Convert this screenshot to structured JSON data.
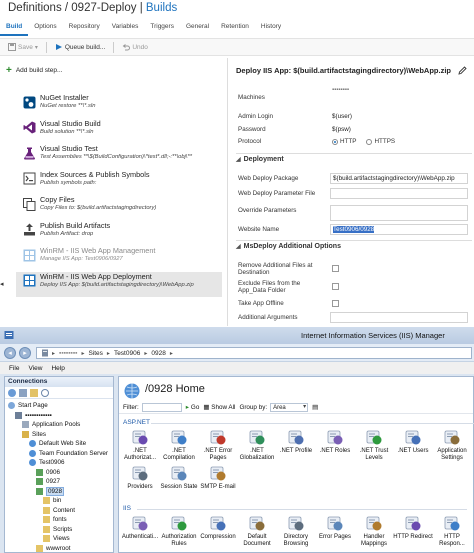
{
  "tfs": {
    "breadcrumb": {
      "part1": "Definitions / 0927-Deploy",
      "sep": " | ",
      "part2": "Builds"
    },
    "tabs": [
      "Build",
      "Options",
      "Repository",
      "Variables",
      "Triggers",
      "General",
      "Retention",
      "History"
    ],
    "toolbar": {
      "save": "Save",
      "queue": "Queue build...",
      "undo": "Undo"
    },
    "add_step": "Add build step...",
    "steps": [
      {
        "name": "NuGet Installer",
        "sub": "NuGet restore **\\*.sln",
        "icon": "nuget-icon",
        "disabled": false
      },
      {
        "name": "Visual Studio Build",
        "sub": "Build solution **\\*.sln",
        "icon": "visual-studio-icon",
        "disabled": false
      },
      {
        "name": "Visual Studio Test",
        "sub": "Test Assemblies **\\$(BuildConfiguration)\\*test*.dll;-:**\\obj\\**",
        "icon": "vs-test-icon",
        "disabled": false
      },
      {
        "name": "Index Sources & Publish Symbols",
        "sub": "Publish symbols path:",
        "icon": "symbols-icon",
        "disabled": false
      },
      {
        "name": "Copy Files",
        "sub": "Copy Files to: $(build.artifactstagingdirectory)",
        "icon": "copy-files-icon",
        "disabled": false
      },
      {
        "name": "Publish Build Artifacts",
        "sub": "Publish Artifact: drop",
        "icon": "publish-artifacts-icon",
        "disabled": false
      },
      {
        "name": "WinRM - IIS Web App Management",
        "sub": "Manage IIS App: Test0906/0927",
        "icon": "winrm-icon",
        "disabled": true
      },
      {
        "name": "WinRM - IIS Web App Deployment",
        "sub": "Deploy IIS App: $(build.artifactstagingdirectory)\\WebApp.zip",
        "icon": "winrm-icon",
        "disabled": false,
        "selected": true
      }
    ],
    "details": {
      "title": "Deploy IIS App: $(build.artifactstagingdirectory)\\WebApp.zip",
      "machines_label": "Machines",
      "machines_value": "▪▪▪▪▪▪▪▪",
      "admin_login_label": "Admin Login",
      "admin_login_value": "$(user)",
      "password_label": "Password",
      "password_value": "$(psw)",
      "protocol_label": "Protocol",
      "protocol_options": [
        "HTTP",
        "HTTPS"
      ],
      "protocol_selected": "HTTP",
      "deployment_section": "Deployment",
      "web_deploy_package_label": "Web Deploy Package",
      "web_deploy_package_value": "$(build.artifactstagingdirectory)\\WebApp.zip",
      "web_deploy_param_label": "Web Deploy Parameter File",
      "override_params_label": "Override Parameters",
      "website_name_label": "Website Name",
      "website_name_value": "Test0906/0928",
      "msdeploy_section": "MsDeploy Additional Options",
      "remove_files_label": "Remove Additional Files at Destination",
      "exclude_files_label": "Exclude Files from the App_Data Folder",
      "take_offline_label": "Take App Offline",
      "additional_args_label": "Additional Arguments"
    }
  },
  "iis": {
    "title": "Internet Information Services (IIS) Manager",
    "address": [
      "▪▪▪▪▪▪▪▪",
      "Sites",
      "Test0906",
      "0928"
    ],
    "menu": [
      "File",
      "View",
      "Help"
    ],
    "connections_title": "Connections",
    "tree": [
      {
        "label": "Start Page",
        "indent": 0,
        "icon": "start-page-icon"
      },
      {
        "label": "▪▪▪▪▪▪▪▪▪▪▪▪",
        "indent": 1,
        "icon": "server-icon"
      },
      {
        "label": "Application Pools",
        "indent": 2,
        "icon": "app-pools-icon"
      },
      {
        "label": "Sites",
        "indent": 2,
        "icon": "sites-icon"
      },
      {
        "label": "Default Web Site",
        "indent": 3,
        "icon": "website-icon"
      },
      {
        "label": "Team Foundation Server",
        "indent": 3,
        "icon": "website-icon"
      },
      {
        "label": "Test0906",
        "indent": 3,
        "icon": "website-icon"
      },
      {
        "label": "0906",
        "indent": 4,
        "icon": "app-icon"
      },
      {
        "label": "0927",
        "indent": 4,
        "icon": "app-icon"
      },
      {
        "label": "0928",
        "indent": 4,
        "icon": "app-icon",
        "selected": true
      },
      {
        "label": "bin",
        "indent": 5,
        "icon": "folder-icon"
      },
      {
        "label": "Content",
        "indent": 5,
        "icon": "folder-icon"
      },
      {
        "label": "fonts",
        "indent": 5,
        "icon": "folder-icon"
      },
      {
        "label": "Scripts",
        "indent": 5,
        "icon": "folder-icon"
      },
      {
        "label": "Views",
        "indent": 5,
        "icon": "folder-icon"
      },
      {
        "label": "wwwroot",
        "indent": 4,
        "icon": "folder-icon"
      }
    ],
    "home_title": "/0928 Home",
    "filter": {
      "label": "Filter:",
      "go": "Go",
      "show_all": "Show All",
      "group_by": "Group by:",
      "group_value": "Area"
    },
    "groups": [
      {
        "name": "ASP.NET",
        "features": [
          {
            "label": ".NET Authorizat...",
            "icon": "net-authorization-icon"
          },
          {
            "label": ".NET Compilation",
            "icon": "net-compilation-icon"
          },
          {
            "label": ".NET Error Pages",
            "icon": "net-error-pages-icon"
          },
          {
            "label": ".NET Globalization",
            "icon": "net-globalization-icon"
          },
          {
            "label": ".NET Profile",
            "icon": "net-profile-icon"
          },
          {
            "label": ".NET Roles",
            "icon": "net-roles-icon"
          },
          {
            "label": ".NET Trust Levels",
            "icon": "net-trust-levels-icon"
          },
          {
            "label": ".NET Users",
            "icon": "net-users-icon"
          },
          {
            "label": "Application Settings",
            "icon": "app-settings-icon"
          },
          {
            "label": "Providers",
            "icon": "providers-icon"
          },
          {
            "label": "Session State",
            "icon": "session-state-icon"
          },
          {
            "label": "SMTP E-mail",
            "icon": "smtp-icon"
          }
        ]
      },
      {
        "name": "IIS",
        "features": [
          {
            "label": "Authenticati...",
            "icon": "authentication-icon"
          },
          {
            "label": "Authorization Rules",
            "icon": "authorization-rules-icon"
          },
          {
            "label": "Compression",
            "icon": "compression-icon"
          },
          {
            "label": "Default Document",
            "icon": "default-document-icon"
          },
          {
            "label": "Directory Browsing",
            "icon": "directory-browsing-icon"
          },
          {
            "label": "Error Pages",
            "icon": "error-pages-icon"
          },
          {
            "label": "Handler Mappings",
            "icon": "handler-mappings-icon"
          },
          {
            "label": "HTTP Redirect",
            "icon": "http-redirect-icon"
          },
          {
            "label": "HTTP Respon...",
            "icon": "http-response-icon"
          }
        ]
      }
    ]
  }
}
